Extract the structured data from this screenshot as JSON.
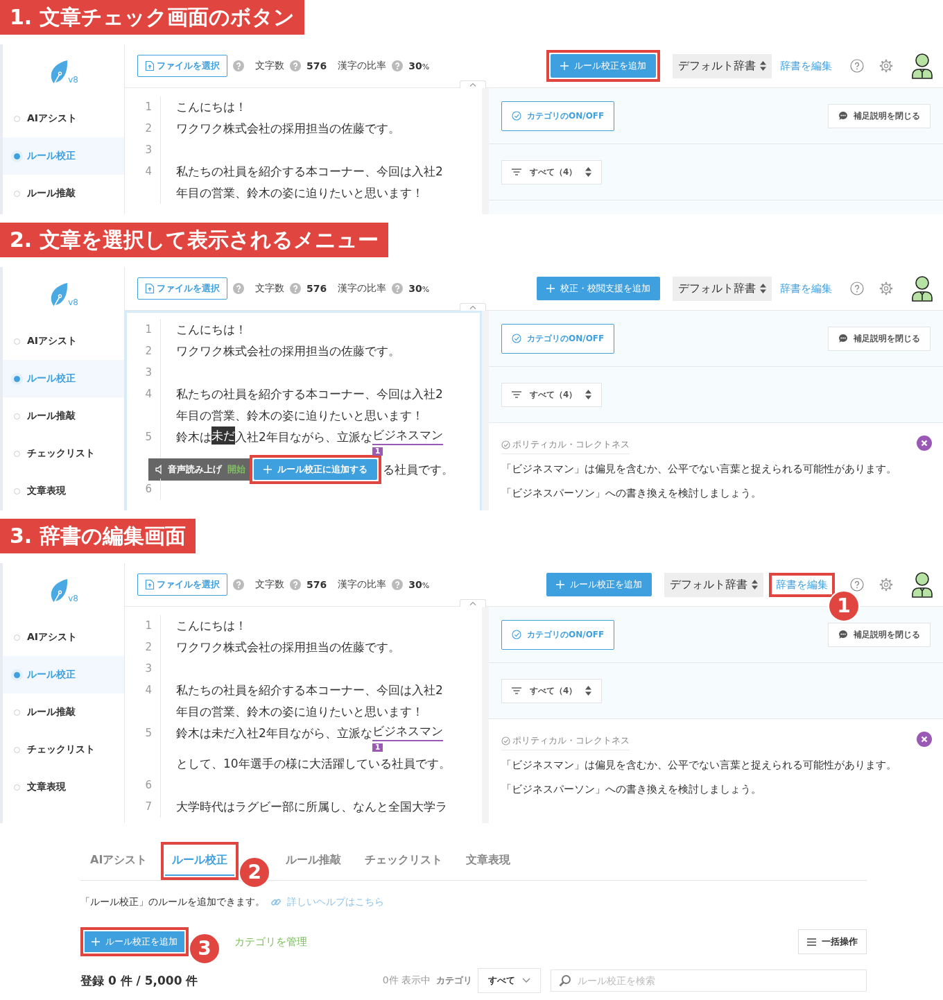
{
  "sections": [
    {
      "heading": "1. 文章チェック画面のボタン",
      "app": {
        "logo_version": "v8",
        "editor_focused": false,
        "sidebar": [
          {
            "label": "AIアシスト",
            "selected": false
          },
          {
            "label": "ルール校正",
            "selected": true
          },
          {
            "label": "ルール推敲",
            "selected": false
          }
        ],
        "toolbar": {
          "file_button": "ファイルを選択",
          "char_count_label": "文字数",
          "char_count": "576",
          "kanji_label": "漢字の比率",
          "kanji_ratio": "30",
          "kanji_unit": "%",
          "add_button": {
            "label": "ルール校正を追加",
            "highlighted": true
          },
          "dictionary": "デフォルト辞書",
          "edit_dictionary": {
            "label": "辞書を編集",
            "highlighted": false
          }
        },
        "lines": [
          {
            "number": "1",
            "rows": [
              {
                "spans": [
                  {
                    "kind": "plain",
                    "text": "こんにちは！"
                  }
                ]
              }
            ]
          },
          {
            "number": "2",
            "rows": [
              {
                "spans": [
                  {
                    "kind": "plain",
                    "text": "ワクワク株式会社の採用担当の佐藤です。"
                  }
                ]
              }
            ]
          },
          {
            "number": "3",
            "rows": [
              {
                "spans": []
              }
            ]
          },
          {
            "number": "4",
            "rows": [
              {
                "spans": [
                  {
                    "kind": "plain",
                    "text": "私たちの社員を紹介する本コーナー、今回は入社2"
                  }
                ]
              },
              {
                "spans": [
                  {
                    "kind": "plain",
                    "text": "年目の営業、鈴木の姿に迫りたいと思います！"
                  }
                ]
              }
            ]
          }
        ],
        "category_button": "カテゴリのON/OFF",
        "notes_button": "補足説明を閉じる",
        "filter": "すべて（4）"
      }
    },
    {
      "heading": "2. 文章を選択して表示されるメニュー",
      "app": {
        "logo_version": "v8",
        "editor_focused": true,
        "sidebar": [
          {
            "label": "AIアシスト",
            "selected": false
          },
          {
            "label": "ルール校正",
            "selected": true
          },
          {
            "label": "ルール推敲",
            "selected": false
          },
          {
            "label": "チェックリスト",
            "selected": false
          },
          {
            "label": "文章表現",
            "selected": false
          }
        ],
        "toolbar": {
          "file_button": "ファイルを選択",
          "char_count_label": "文字数",
          "char_count": "576",
          "kanji_label": "漢字の比率",
          "kanji_ratio": "30",
          "kanji_unit": "%",
          "add_button": {
            "label": "校正・校閲支援を追加",
            "highlighted": false
          },
          "dictionary": "デフォルト辞書",
          "edit_dictionary": {
            "label": "辞書を編集",
            "highlighted": false
          }
        },
        "lines": [
          {
            "number": "1",
            "rows": [
              {
                "spans": [
                  {
                    "kind": "plain",
                    "text": "こんにちは！"
                  }
                ]
              }
            ]
          },
          {
            "number": "2",
            "rows": [
              {
                "spans": [
                  {
                    "kind": "plain",
                    "text": "ワクワク株式会社の採用担当の佐藤です。"
                  }
                ]
              }
            ]
          },
          {
            "number": "3",
            "rows": [
              {
                "spans": []
              }
            ]
          },
          {
            "number": "4",
            "rows": [
              {
                "spans": [
                  {
                    "kind": "plain",
                    "text": "私たちの社員を紹介する本コーナー、今回は入社2"
                  }
                ]
              },
              {
                "spans": [
                  {
                    "kind": "plain",
                    "text": "年目の営業、鈴木の姿に迫りたいと思います！"
                  }
                ]
              }
            ]
          },
          {
            "number": "5",
            "rows": [
              {
                "spans": [
                  {
                    "kind": "plain",
                    "text": "鈴木は"
                  },
                  {
                    "kind": "selection",
                    "text": "未だ"
                  },
                  {
                    "kind": "plain",
                    "text": "入社2年目ながら、立派な"
                  },
                  {
                    "kind": "flag",
                    "text": "ビジネスマン",
                    "badge": "1"
                  }
                ]
              },
              {
                "spans": [
                  {
                    "kind": "menu",
                    "speech_label": "音声読み上げ",
                    "speech_action": "開始",
                    "add_button": {
                      "label": "ルール校正に追加する",
                      "highlighted": true
                    }
                  },
                  {
                    "kind": "plain",
                    "text": "る社員です。"
                  }
                ]
              }
            ]
          },
          {
            "number": "6",
            "rows": [
              {
                "spans": []
              }
            ]
          }
        ],
        "category_button": "カテゴリのON/OFF",
        "notes_button": "補足説明を閉じる",
        "filter": "すべて（4）",
        "suggestion": {
          "category": "ポリティカル・コレクトネス",
          "message": [
            "「ビジネスマン」は偏見を含むか、公平でない言葉と捉えられる可能性があります。",
            "「ビジネスパーソン」への書き換えを検討しましょう。"
          ]
        }
      }
    },
    {
      "heading": "3. 辞書の編集画面",
      "app": {
        "logo_version": "v8",
        "editor_focused": false,
        "sidebar": [
          {
            "label": "AIアシスト",
            "selected": false
          },
          {
            "label": "ルール校正",
            "selected": true
          },
          {
            "label": "ルール推敲",
            "selected": false
          },
          {
            "label": "チェックリスト",
            "selected": false
          },
          {
            "label": "文章表現",
            "selected": false
          }
        ],
        "toolbar": {
          "file_button": "ファイルを選択",
          "char_count_label": "文字数",
          "char_count": "576",
          "kanji_label": "漢字の比率",
          "kanji_ratio": "30",
          "kanji_unit": "%",
          "add_button": {
            "label": "ルール校正を追加",
            "highlighted": false
          },
          "dictionary": "デフォルト辞書",
          "edit_dictionary": {
            "label": "辞書を編集",
            "highlighted": true,
            "callout": "1"
          }
        },
        "lines": [
          {
            "number": "1",
            "rows": [
              {
                "spans": [
                  {
                    "kind": "plain",
                    "text": "こんにちは！"
                  }
                ]
              }
            ]
          },
          {
            "number": "2",
            "rows": [
              {
                "spans": [
                  {
                    "kind": "plain",
                    "text": "ワクワク株式会社の採用担当の佐藤です。"
                  }
                ]
              }
            ]
          },
          {
            "number": "3",
            "rows": [
              {
                "spans": []
              }
            ]
          },
          {
            "number": "4",
            "rows": [
              {
                "spans": [
                  {
                    "kind": "plain",
                    "text": "私たちの社員を紹介する本コーナー、今回は入社2"
                  }
                ]
              },
              {
                "spans": [
                  {
                    "kind": "plain",
                    "text": "年目の営業、鈴木の姿に迫りたいと思います！"
                  }
                ]
              }
            ]
          },
          {
            "number": "5",
            "rows": [
              {
                "spans": [
                  {
                    "kind": "plain",
                    "text": "鈴木は未だ入社2年目ながら、立派な"
                  },
                  {
                    "kind": "flag",
                    "text": "ビジネスマン",
                    "badge": "1"
                  }
                ]
              },
              {
                "spans": [
                  {
                    "kind": "plain",
                    "text": "として、10年選手の様に大活躍している社員です。"
                  }
                ]
              }
            ]
          },
          {
            "number": "6",
            "rows": [
              {
                "spans": []
              }
            ]
          },
          {
            "number": "7",
            "rows": [
              {
                "spans": [
                  {
                    "kind": "plain",
                    "text": "大学時代はラグビー部に所属し、なんと全国大学ラ"
                  }
                ]
              }
            ]
          }
        ],
        "category_button": "カテゴリのON/OFF",
        "notes_button": "補足説明を閉じる",
        "filter": "すべて（4）",
        "suggestion": {
          "category": "ポリティカル・コレクトネス",
          "message": [
            "「ビジネスマン」は偏見を含むか、公平でない言葉と捉えられる可能性があります。",
            "「ビジネスパーソン」への書き換えを検討しましょう。"
          ]
        }
      },
      "dictionary_editor": {
        "tabs": [
          {
            "label": "AIアシスト",
            "selected": false,
            "highlighted": false
          },
          {
            "label": "ルール校正",
            "selected": true,
            "highlighted": true,
            "callout": "2"
          },
          {
            "label": "ルール推敲",
            "selected": false,
            "highlighted": false
          },
          {
            "label": "チェックリスト",
            "selected": false,
            "highlighted": false
          },
          {
            "label": "文章表現",
            "selected": false,
            "highlighted": false
          }
        ],
        "description": "「ルール校正」のルールを追加できます。",
        "help_link": "詳しいヘルプはこちら",
        "add_button": {
          "label": "ルール校正を追加",
          "highlighted": true,
          "callout": "3"
        },
        "manage_link": "カテゴリを管理",
        "bulk_button": "一括操作",
        "registered": "登録 0 件 / 5,000 件",
        "showing": "0件 表示中",
        "category_label": "カテゴリ",
        "category_select": "すべて",
        "search_placeholder": "ルール校正を検索"
      }
    }
  ]
}
